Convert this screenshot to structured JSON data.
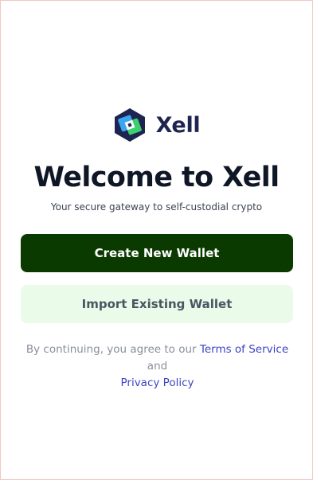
{
  "brand": {
    "name": "Xell",
    "logo_icon": "xell-hexagon-logo",
    "colors": {
      "hex_dark": "#1e2450",
      "card_blue": "#3aa6f2",
      "card_green": "#3ccf6e"
    }
  },
  "welcome": {
    "title": "Welcome to Xell",
    "subtitle": "Your secure gateway to self-custodial crypto"
  },
  "actions": {
    "create_label": "Create New Wallet",
    "import_label": "Import Existing Wallet"
  },
  "legal": {
    "prefix": "By continuing, you agree to our",
    "terms_label": "Terms of Service",
    "and_text": "and",
    "privacy_label": "Privacy Policy"
  },
  "colors": {
    "primary_button": "#0b3a00",
    "secondary_button": "#ebfbe9",
    "link": "#3c45c4"
  }
}
